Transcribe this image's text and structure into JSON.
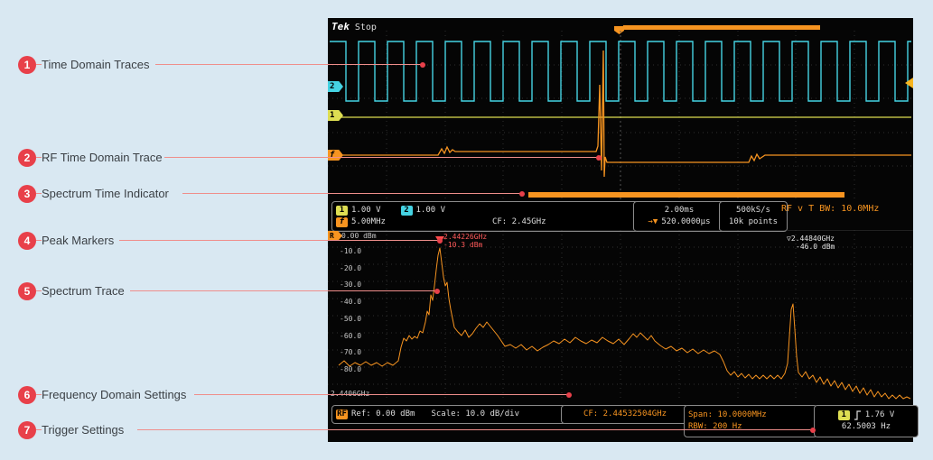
{
  "callouts": [
    {
      "num": "1",
      "label": "Time Domain Traces"
    },
    {
      "num": "2",
      "label": "RF Time Domain Trace"
    },
    {
      "num": "3",
      "label": "Spectrum Time Indicator"
    },
    {
      "num": "4",
      "label": "Peak Markers"
    },
    {
      "num": "5",
      "label": "Spectrum Trace"
    },
    {
      "num": "6",
      "label": "Frequency Domain Settings"
    },
    {
      "num": "7",
      "label": "Trigger Settings"
    }
  ],
  "icons": {
    "delay_marker": "→▼",
    "marker2": "▽"
  },
  "scope": {
    "logo": "Tek",
    "status": "Stop",
    "ch1_num": "1",
    "ch1_scale": "1.00 V",
    "ch2_num": "2",
    "ch2_scale": "1.00 V",
    "rf_num": "f",
    "rf_scale": "5.00MHz",
    "cf_mid": "CF:   2.45GHz",
    "timebase": "2.00ms",
    "delay": "520.0000µs",
    "sample_rate": "500kS/s",
    "record_length": "10k points",
    "rf_bw": "RF v T BW: 10.0MHz",
    "spectrum": {
      "ref": "0.00 dBm",
      "ticks": [
        "-10.0",
        "-20.0",
        "-30.0",
        "-40.0",
        "-50.0",
        "-60.0",
        "-70.0",
        "-80.0"
      ],
      "start_freq": "2.4406GHz",
      "rf_badge": "R",
      "marker1_freq": "2.44226GHz",
      "marker1_amp": "-10.3 dBm",
      "marker2_freq": "2.44840GHz",
      "marker2_amp": "-46.0 dBm"
    },
    "bottom": {
      "rf_badge": "RF",
      "ref": "Ref: 0.00 dBm",
      "scale": "Scale: 10.0 dB/div",
      "cf": "CF: 2.44532504GHz",
      "span": "Span:  10.0000MHz",
      "rbw": "RBW:   200 Hz",
      "trig_ch": "1",
      "trig_level": "1.76 V",
      "trig_freq": "62.5003 Hz"
    }
  }
}
